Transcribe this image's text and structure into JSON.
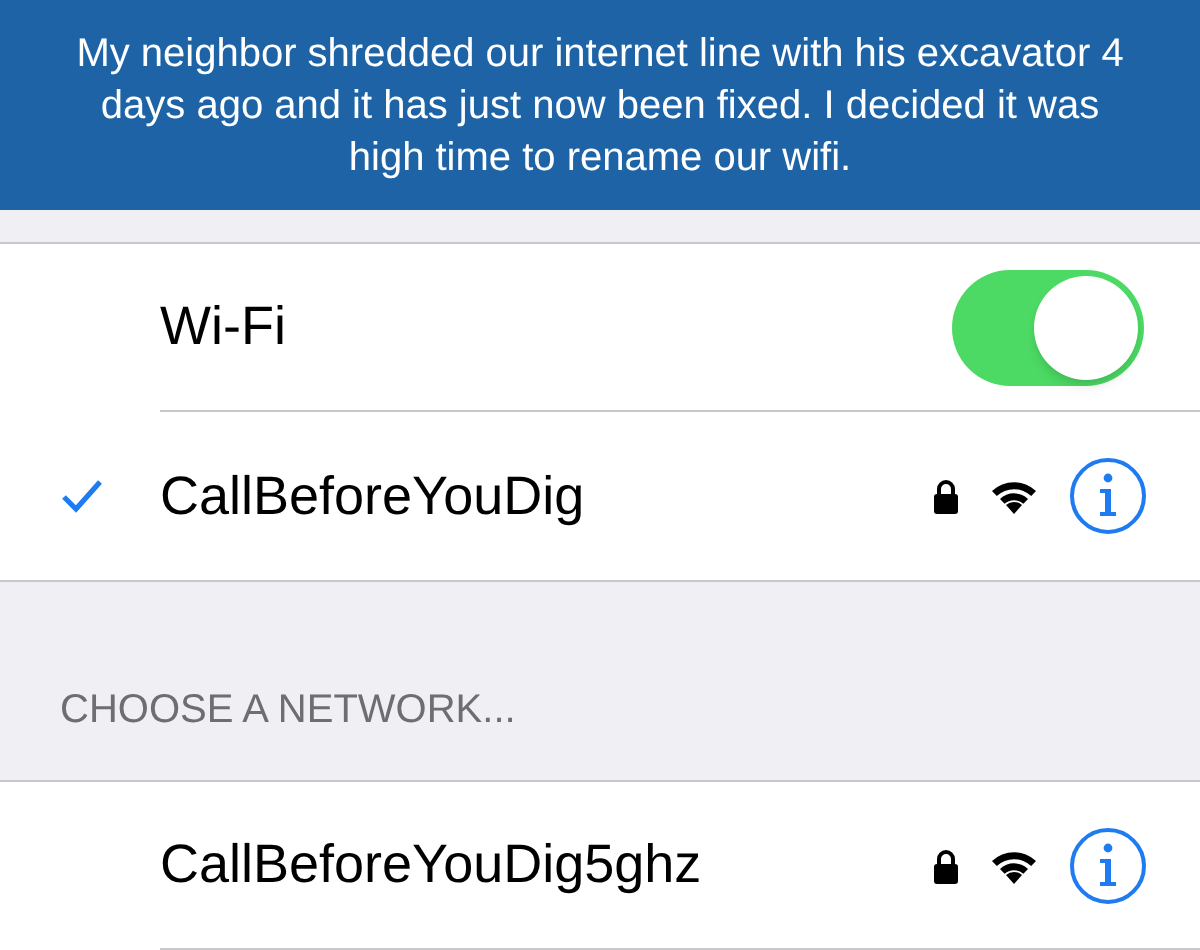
{
  "caption": "My neighbor shredded our internet line with his excavator 4 days ago and it has just now been fixed. I decided it was high time to rename our wifi.",
  "wifi": {
    "label": "Wi-Fi",
    "on": true
  },
  "connected": {
    "name": "CallBeforeYouDig",
    "selected": true,
    "locked": true
  },
  "section_header": "CHOOSE A NETWORK...",
  "networks": [
    {
      "name": "CallBeforeYouDig5ghz",
      "selected": false,
      "locked": true
    }
  ]
}
